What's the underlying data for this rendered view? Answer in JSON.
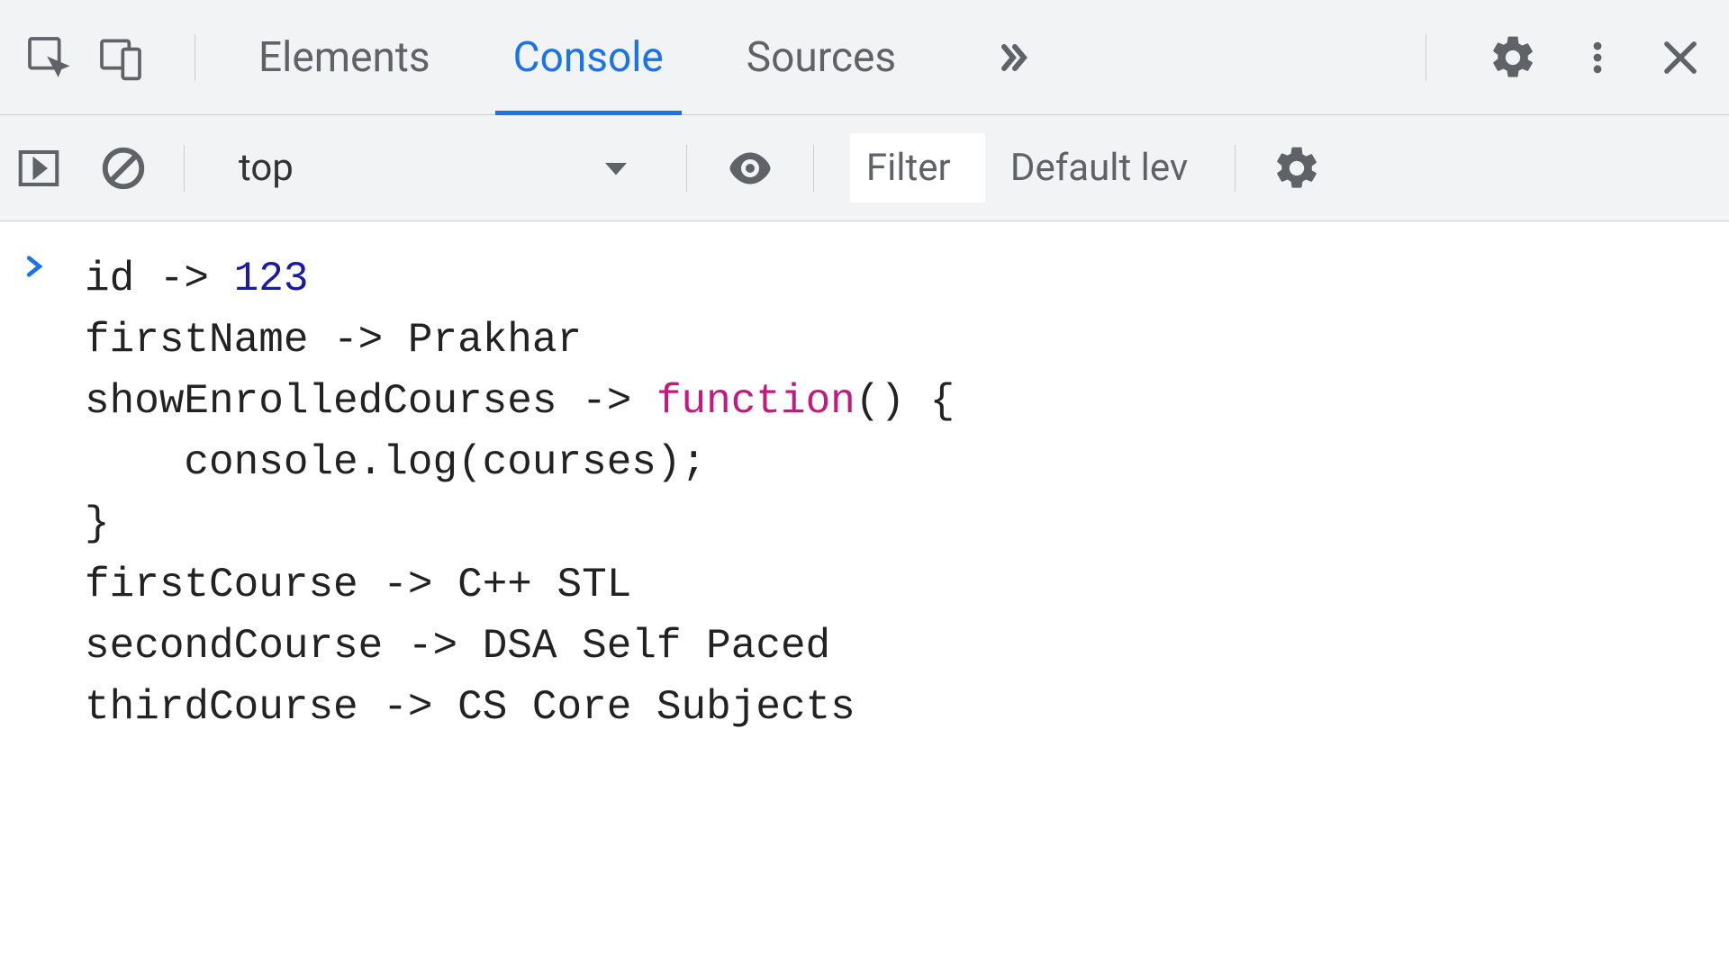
{
  "tabs": {
    "elements": "Elements",
    "console": "Console",
    "sources": "Sources"
  },
  "toolbar": {
    "context": "top",
    "filter_placeholder": "Filter",
    "levels": "Default lev"
  },
  "console": {
    "line1": {
      "key": "id",
      "arrow": "->",
      "value": "123"
    },
    "line2": {
      "key": "firstName",
      "arrow": "->",
      "value": "Prakhar"
    },
    "line3": {
      "key": "showEnrolledCourses",
      "arrow": "->",
      "kw": "function",
      "after": "() {"
    },
    "line4": {
      "text": "console.log(courses);"
    },
    "line5": {
      "text": "}"
    },
    "line6": {
      "key": "firstCourse",
      "arrow": "->",
      "value": "C++ STL"
    },
    "line7": {
      "key": "secondCourse",
      "arrow": "->",
      "value": "DSA Self Paced"
    },
    "line8": {
      "key": "thirdCourse",
      "arrow": "->",
      "value": "CS Core Subjects"
    }
  }
}
